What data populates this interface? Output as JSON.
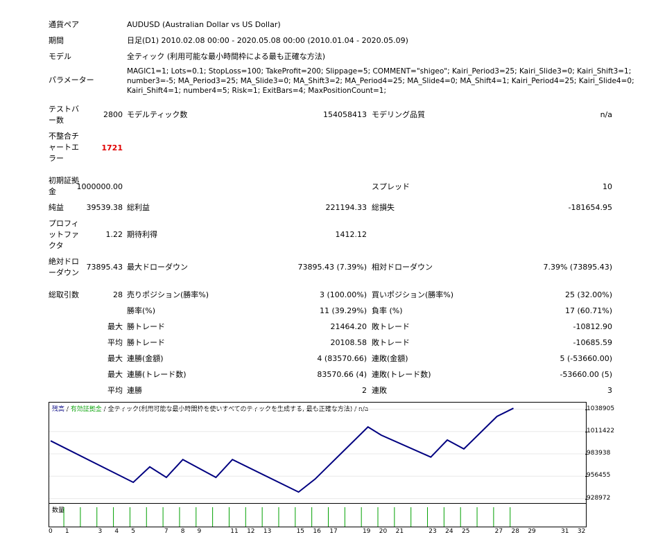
{
  "report": {
    "symbol": {
      "label": "通貨ペア",
      "value": "AUDUSD (Australian Dollar vs US Dollar)"
    },
    "period": {
      "label": "期間",
      "value": "日足(D1) 2010.02.08 00:00 - 2020.05.08 00:00 (2010.01.04 - 2020.05.09)"
    },
    "model": {
      "label": "モデル",
      "value": "全ティック (利用可能な最小時間枠による最も正確な方法)"
    },
    "parameters": {
      "label": "パラメーター",
      "lines": [
        "MAGIC1=1; Lots=0.1; StopLoss=100; TakeProfit=200; Slippage=5; COMMENT=\"shigeo\"; Kairi_Period3=25; Kairi_Slide3=0; Kairi_Shift3=1;",
        "number3=-5; MA_Period3=25; MA_Slide3=0; MA_Shift3=2; MA_Period4=25; MA_Slide4=0; MA_Shift4=1; Kairi_Period4=25; Kairi_Slide4=0;",
        "Kairi_Shift4=1; number4=5; Risk=1; ExitBars=4; MaxPositionCount=1;"
      ]
    },
    "bars": {
      "label_lines": [
        "テストバ",
        "ー数"
      ],
      "value": "2800"
    },
    "ticks": {
      "label": "モデルティック数",
      "value": "154058413"
    },
    "quality": {
      "label": "モデリング品質",
      "value": "n/a"
    },
    "mismatch": {
      "label_lines": [
        "不整合チ",
        "ャートエ",
        "ラー"
      ],
      "value": "1721"
    },
    "deposit": {
      "label_lines": [
        "初期証拠",
        "金"
      ],
      "value": "1000000.00"
    },
    "spread": {
      "label": "スプレッド",
      "value": "10"
    },
    "net_profit": {
      "label": "純益",
      "value": "39539.38"
    },
    "gross_profit": {
      "label": "総利益",
      "value": "221194.33"
    },
    "gross_loss": {
      "label": "総損失",
      "value": "-181654.95"
    },
    "profit_factor": {
      "label_lines": [
        "プロフィ",
        "ットファ",
        "クタ"
      ],
      "value": "1.22"
    },
    "expected_payoff": {
      "label": "期待利得",
      "value": "1412.12"
    },
    "abs_dd": {
      "label_lines": [
        "絶対ドロ",
        "ーダウン"
      ],
      "value": "73895.43"
    },
    "max_dd": {
      "label": "最大ドローダウン",
      "value": "73895.43 (7.39%)"
    },
    "rel_dd": {
      "label": "相対ドローダウン",
      "value": "7.39% (73895.43)"
    },
    "total_trades": {
      "label": "総取引数",
      "value": "28"
    },
    "short_pos": {
      "label": "売りポジション(勝率%)",
      "value": "3 (100.00%)"
    },
    "long_pos": {
      "label": "買いポジション(勝率%)",
      "value": "25 (32.00%)"
    },
    "win_rate": {
      "label": "勝率(%)",
      "value": "11 (39.29%)"
    },
    "loss_rate": {
      "label": "負率 (%)",
      "value": "17 (60.71%)"
    },
    "largest": {
      "prefix": "最大",
      "win_label": "勝トレード",
      "win": "21464.20",
      "loss_label": "敗トレード",
      "loss": "-10812.90"
    },
    "average": {
      "prefix": "平均",
      "win_label": "勝トレード",
      "win": "20108.58",
      "loss_label": "敗トレード",
      "loss": "-10685.59"
    },
    "max_consec_money": {
      "prefix": "最大",
      "win_label": "連勝(金額)",
      "win": "4 (83570.66)",
      "loss_label": "連敗(金額)",
      "loss": "5 (-53660.00)"
    },
    "max_consec_count": {
      "prefix": "最大",
      "win_label": "連勝(トレード数)",
      "win": "83570.66 (4)",
      "loss_label": "連敗(トレード数)",
      "loss": "-53660.00 (5)"
    },
    "avg_consec": {
      "prefix": "平均",
      "win_label": "連勝",
      "win": "2",
      "loss_label": "連敗",
      "loss": "3"
    }
  },
  "chart_legend": {
    "balance": "残高",
    "sep1": " / ",
    "equity": "有効証拠金",
    "sep2": " / ",
    "model": "全ティック(利用可能な最小時間枠を使いすべてのティックを生成する, 最も正確な方法)",
    "sep3": " / ",
    "quality": "n/a"
  },
  "volume_label": "数量",
  "colors": {
    "balance": "#000080",
    "equity": "#00a000",
    "volume": "#00a000",
    "error": "#e00000"
  },
  "chart_data": {
    "type": "line",
    "title": "",
    "xlabel": "",
    "ylabel": "",
    "x_ticks": [
      0,
      1,
      3,
      4,
      5,
      7,
      8,
      9,
      11,
      12,
      13,
      15,
      16,
      17,
      19,
      20,
      21,
      23,
      24,
      25,
      27,
      28,
      29,
      31,
      32
    ],
    "y_ticks": [
      1038905,
      1011422,
      983938,
      956455,
      928972
    ],
    "xlim": [
      0,
      32.3
    ],
    "ylim": [
      923500,
      1047000
    ],
    "series": [
      {
        "name": "残高",
        "x": [
          0,
          5,
          6,
          7,
          8,
          10,
          11,
          15,
          16,
          19.2,
          20,
          23,
          24,
          25,
          27,
          28
        ],
        "y": [
          1000000,
          949000,
          968000,
          955000,
          977000,
          955000,
          977000,
          937000,
          953000,
          1017000,
          1007000,
          980000,
          1001000,
          990000,
          1030000,
          1040000
        ]
      }
    ],
    "volume_x": [
      1,
      2,
      3,
      4,
      5,
      6,
      7,
      8,
      9,
      10,
      11,
      12,
      13,
      14,
      15,
      16,
      17,
      18,
      19,
      20,
      21,
      22,
      23,
      24,
      25,
      26,
      27,
      28
    ],
    "volume_values": [
      1,
      1,
      1,
      1,
      1,
      1,
      1,
      1,
      1,
      1,
      1,
      1,
      1,
      1,
      1,
      1,
      1,
      1,
      1,
      1,
      1,
      1,
      1,
      1,
      1,
      1,
      1,
      1
    ]
  }
}
